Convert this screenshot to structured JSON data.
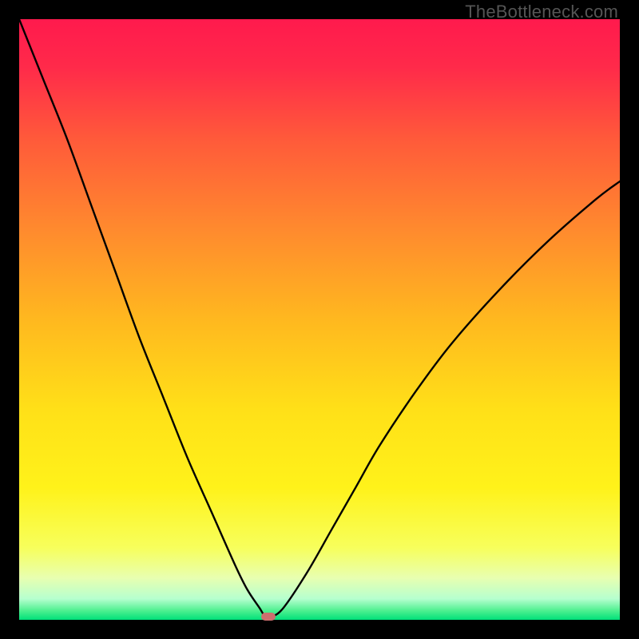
{
  "watermark": "TheBottleneck.com",
  "chart_data": {
    "type": "line",
    "title": "",
    "xlabel": "",
    "ylabel": "",
    "xlim": [
      0,
      100
    ],
    "ylim": [
      0,
      100
    ],
    "grid": false,
    "gradient_stops": [
      {
        "offset": 0.0,
        "color": "#ff1a4d"
      },
      {
        "offset": 0.08,
        "color": "#ff2a4a"
      },
      {
        "offset": 0.2,
        "color": "#ff5a3a"
      },
      {
        "offset": 0.35,
        "color": "#ff8a2e"
      },
      {
        "offset": 0.5,
        "color": "#ffb81f"
      },
      {
        "offset": 0.65,
        "color": "#ffe018"
      },
      {
        "offset": 0.78,
        "color": "#fff21a"
      },
      {
        "offset": 0.88,
        "color": "#f7ff5c"
      },
      {
        "offset": 0.93,
        "color": "#e8ffb0"
      },
      {
        "offset": 0.965,
        "color": "#b6ffcf"
      },
      {
        "offset": 0.985,
        "color": "#4cf08f"
      },
      {
        "offset": 1.0,
        "color": "#00e07a"
      }
    ],
    "series": [
      {
        "name": "bottleneck-curve",
        "x": [
          0,
          4,
          8,
          12,
          16,
          20,
          24,
          28,
          32,
          36,
          38,
          40,
          41,
          42,
          44,
          48,
          52,
          56,
          60,
          66,
          72,
          80,
          88,
          96,
          100
        ],
        "y": [
          100,
          90,
          80,
          69,
          58,
          47,
          37,
          27,
          18,
          9,
          5,
          2,
          0.5,
          0.5,
          2,
          8,
          15,
          22,
          29,
          38,
          46,
          55,
          63,
          70,
          73
        ]
      }
    ],
    "marker": {
      "x": 41.5,
      "y": 0.5,
      "color": "#cc6f6e"
    },
    "curve_color": "#000000",
    "curve_width": 2.4
  }
}
